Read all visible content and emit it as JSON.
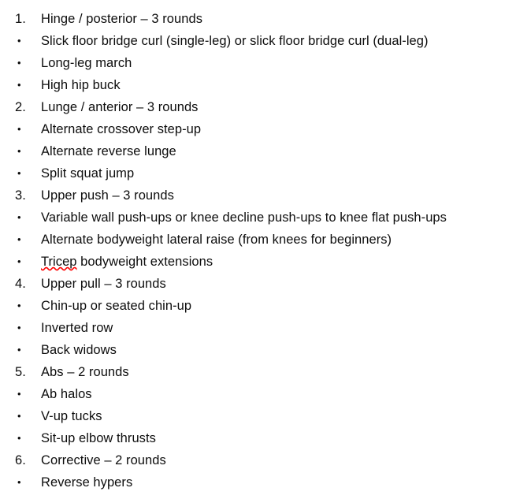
{
  "document": {
    "type": "bulleted-numbered-list",
    "background_color": "#ffffff",
    "text_color": "#0d0d0d",
    "spellcheck_underline_color": "#ff0000"
  },
  "lines": [
    {
      "marker_type": "number",
      "marker": "1.",
      "text": "Hinge / posterior – 3 rounds",
      "misspelled_word": ""
    },
    {
      "marker_type": "bullet",
      "marker": "•",
      "text": "Slick floor bridge curl (single-leg) or slick floor bridge curl (dual-leg)",
      "misspelled_word": ""
    },
    {
      "marker_type": "bullet",
      "marker": "•",
      "text": "Long-leg march",
      "misspelled_word": ""
    },
    {
      "marker_type": "bullet",
      "marker": "•",
      "text": "High hip buck",
      "misspelled_word": ""
    },
    {
      "marker_type": "number",
      "marker": "2.",
      "text": "Lunge / anterior – 3 rounds",
      "misspelled_word": ""
    },
    {
      "marker_type": "bullet",
      "marker": "•",
      "text": "Alternate crossover step-up",
      "misspelled_word": ""
    },
    {
      "marker_type": "bullet",
      "marker": "•",
      "text": "Alternate reverse lunge",
      "misspelled_word": ""
    },
    {
      "marker_type": "bullet",
      "marker": "•",
      "text": "Split squat jump",
      "misspelled_word": ""
    },
    {
      "marker_type": "number",
      "marker": "3.",
      "text": "Upper push – 3 rounds",
      "misspelled_word": ""
    },
    {
      "marker_type": "bullet",
      "marker": "•",
      "text": "Variable wall push-ups or knee decline push-ups to knee flat push-ups",
      "misspelled_word": ""
    },
    {
      "marker_type": "bullet",
      "marker": "•",
      "text": "Alternate bodyweight lateral raise (from knees for beginners)",
      "misspelled_word": ""
    },
    {
      "marker_type": "bullet",
      "marker": "•",
      "text": "Tricep bodyweight extensions",
      "misspelled_word": "Tricep"
    },
    {
      "marker_type": "number",
      "marker": "4.",
      "text": "Upper pull – 3 rounds",
      "misspelled_word": ""
    },
    {
      "marker_type": "bullet",
      "marker": "•",
      "text": "Chin-up or seated chin-up",
      "misspelled_word": ""
    },
    {
      "marker_type": "bullet",
      "marker": "•",
      "text": "Inverted row",
      "misspelled_word": ""
    },
    {
      "marker_type": "bullet",
      "marker": "•",
      "text": "Back widows",
      "misspelled_word": ""
    },
    {
      "marker_type": "number",
      "marker": "5.",
      "text": "Abs – 2 rounds",
      "misspelled_word": ""
    },
    {
      "marker_type": "bullet",
      "marker": "•",
      "text": "Ab halos",
      "misspelled_word": ""
    },
    {
      "marker_type": "bullet",
      "marker": "•",
      "text": "V-up tucks",
      "misspelled_word": ""
    },
    {
      "marker_type": "bullet",
      "marker": "•",
      "text": "Sit-up elbow thrusts",
      "misspelled_word": ""
    },
    {
      "marker_type": "number",
      "marker": "6.",
      "text": "Corrective – 2 rounds",
      "misspelled_word": ""
    },
    {
      "marker_type": "bullet",
      "marker": "•",
      "text": "Reverse hypers",
      "misspelled_word": ""
    }
  ]
}
